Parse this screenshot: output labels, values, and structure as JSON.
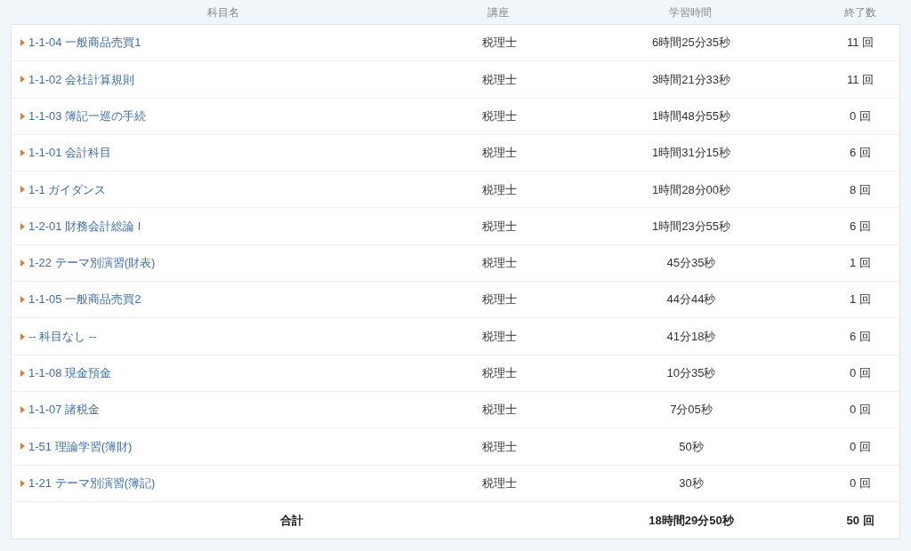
{
  "table": {
    "columns": [
      "科目名",
      "講座",
      "学習時間",
      "終了数"
    ],
    "rows": [
      {
        "subject": "1-1-04 一般商品売買1",
        "course": "税理士",
        "time": "6時間25分35秒",
        "count": "11 回"
      },
      {
        "subject": "1-1-02 会社計算規則",
        "course": "税理士",
        "time": "3時間21分33秒",
        "count": "11 回"
      },
      {
        "subject": "1-1-03 簿記一巡の手続",
        "course": "税理士",
        "time": "1時間48分55秒",
        "count": "0 回"
      },
      {
        "subject": "1-1-01 会計科目",
        "course": "税理士",
        "time": "1時間31分15秒",
        "count": "6 回"
      },
      {
        "subject": "1-1 ガイダンス",
        "course": "税理士",
        "time": "1時間28分00秒",
        "count": "8 回"
      },
      {
        "subject": "1-2-01 財務会計総論 I",
        "course": "税理士",
        "time": "1時間23分55秒",
        "count": "6 回"
      },
      {
        "subject": "1-22 テーマ別演習(財表)",
        "course": "税理士",
        "time": "45分35秒",
        "count": "1 回"
      },
      {
        "subject": "1-1-05 一般商品売買2",
        "course": "税理士",
        "time": "44分44秒",
        "count": "1 回"
      },
      {
        "subject": "-- 科目なし --",
        "course": "税理士",
        "time": "41分18秒",
        "count": "6 回"
      },
      {
        "subject": "1-1-08 現金預金",
        "course": "税理士",
        "time": "10分35秒",
        "count": "0 回"
      },
      {
        "subject": "1-1-07 諸税金",
        "course": "税理士",
        "time": "7分05秒",
        "count": "0 回"
      },
      {
        "subject": "1-51 理論学習(簿財)",
        "course": "税理士",
        "time": "50秒",
        "count": "0 回"
      },
      {
        "subject": "1-21 テーマ別演習(簿記)",
        "course": "税理士",
        "time": "30秒",
        "count": "0 回"
      }
    ],
    "total": {
      "label": "合計",
      "time": "18時間29分50秒",
      "count": "50 回"
    }
  }
}
